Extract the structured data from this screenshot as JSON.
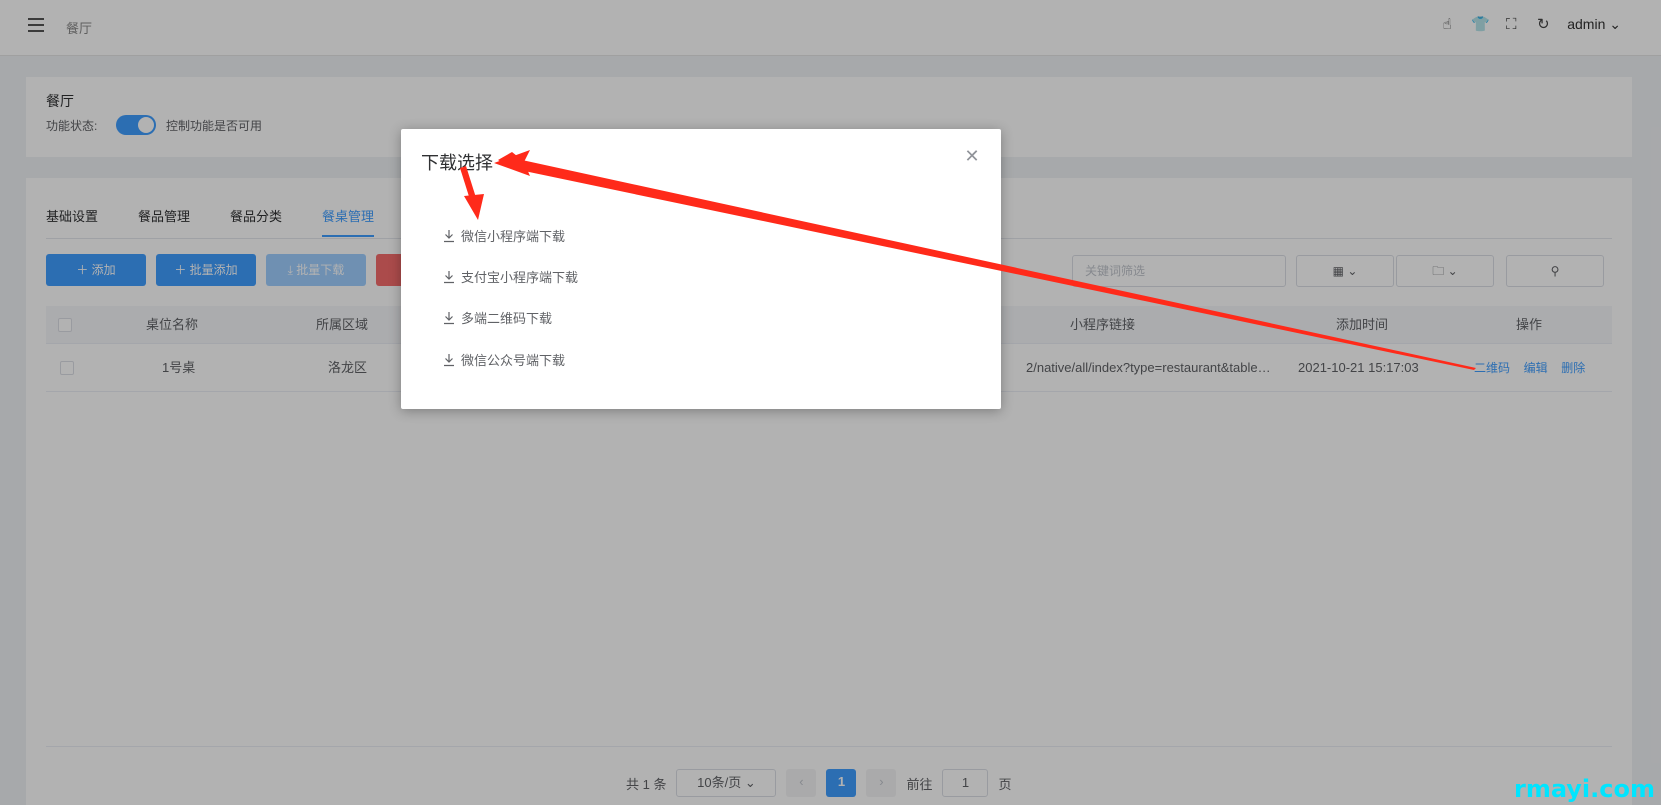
{
  "header": {
    "breadcrumb": "餐厅",
    "user": "admin",
    "icons": [
      "thumb-icon",
      "shirt-icon",
      "fullscreen-icon",
      "refresh-icon"
    ]
  },
  "module": {
    "title": "餐厅",
    "status_label": "功能状态:",
    "status_desc": "控制功能是否可用",
    "enabled": true
  },
  "tabs": [
    {
      "label": "基础设置"
    },
    {
      "label": "餐品管理"
    },
    {
      "label": "餐品分类"
    },
    {
      "label": "餐桌管理"
    }
  ],
  "toolbar": {
    "add": "＋ 添加",
    "batch_add": "＋ 批量添加",
    "batch_download": "⤓ 批量下载",
    "keyword_placeholder": "关键词筛选"
  },
  "table": {
    "headers": {
      "name": "桌位名称",
      "area": "所属区域",
      "link": "小程序链接",
      "time": "添加时间",
      "ops": "操作"
    },
    "rows": [
      {
        "name": "1号桌",
        "area": "洛龙区",
        "link": "2/native/all/index?type=restaurant&table…",
        "time": "2021-10-21 15:17:03",
        "op_qr": "二维码",
        "op_edit": "编辑",
        "op_delete": "删除"
      }
    ]
  },
  "pagination": {
    "total": "共 1 条",
    "page_size": "10条/页",
    "current": "1",
    "goto_label": "前往",
    "goto_value": "1",
    "page_unit": "页"
  },
  "dialog": {
    "title": "下载选择",
    "items": [
      {
        "label": "微信小程序端下载"
      },
      {
        "label": "支付宝小程序端下载"
      },
      {
        "label": "多端二维码下载"
      },
      {
        "label": "微信公众号端下载"
      }
    ]
  },
  "colors": {
    "primary": "#409eff",
    "danger": "#f56c6c",
    "annotation": "#ff2a1a"
  },
  "watermark": "rmayi.com"
}
